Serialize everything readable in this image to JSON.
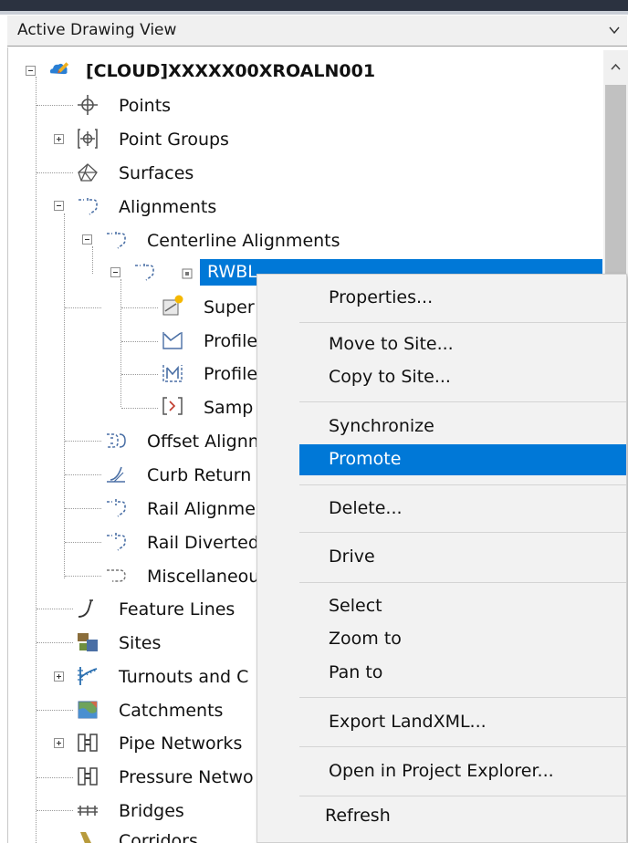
{
  "dropdown": {
    "value": "Active Drawing View"
  },
  "tree": {
    "root": "[CLOUD]XXXXX00XROALN001",
    "points": "Points",
    "point_groups": "Point Groups",
    "surfaces": "Surfaces",
    "alignments": "Alignments",
    "centerline_alignments": "Centerline Alignments",
    "rwbl": "RWBL",
    "super": "Super",
    "profile1": "Profile",
    "profile2": "Profile",
    "samp": "Samp",
    "offset_alignments": "Offset Alignn",
    "curb_return": "Curb Return",
    "rail_alignments": "Rail Alignme",
    "rail_diverted": "Rail Diverted",
    "miscellaneous": "Miscellaneou",
    "feature_lines": "Feature Lines",
    "sites": "Sites",
    "turnouts": "Turnouts and C",
    "catchments": "Catchments",
    "pipe_networks": "Pipe Networks",
    "pressure_networks": "Pressure Netwo",
    "bridges": "Bridges",
    "corridors": "Corridors"
  },
  "menu": {
    "properties": "Properties...",
    "move_to_site": "Move to Site...",
    "copy_to_site": "Copy to Site...",
    "synchronize": "Synchronize",
    "promote": "Promote",
    "delete": "Delete...",
    "drive": "Drive",
    "select": "Select",
    "zoom_to": "Zoom to",
    "pan_to": "Pan to",
    "export_landxml": "Export LandXML...",
    "open_in_project_explorer": "Open in Project Explorer...",
    "refresh": "Refresh"
  },
  "colors": {
    "selection": "#0078d7",
    "menu_bg": "#f2f2f2",
    "header": "#2b3240"
  }
}
